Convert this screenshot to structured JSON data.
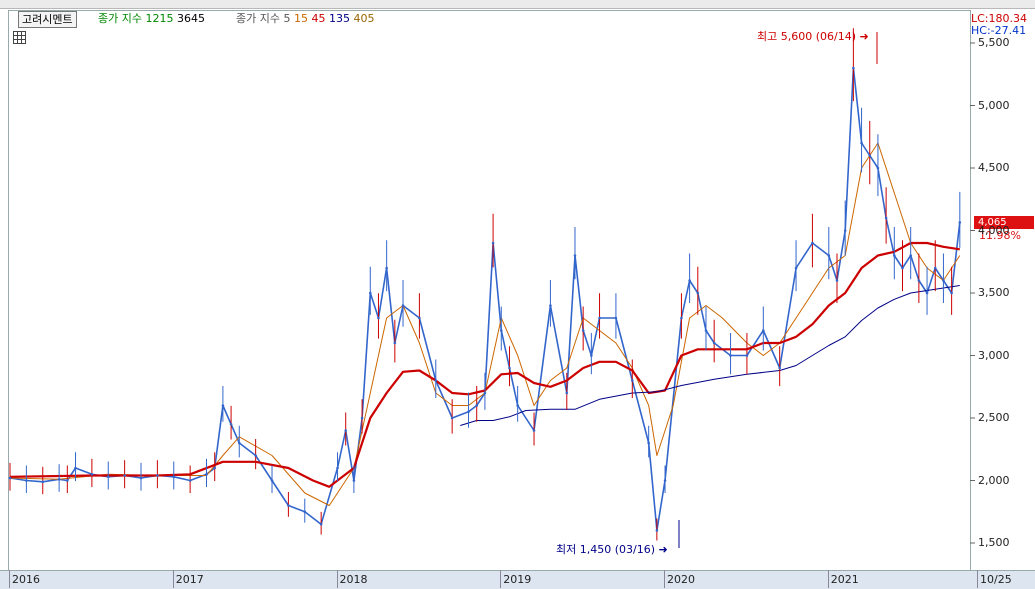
{
  "legend": {
    "stock_name": "고려시멘트",
    "ma_label": "종가 지수",
    "ma_periods": [
      "12",
      "15",
      "3645"
    ],
    "ma2_label": "종가 지수 5",
    "ma2_periods": [
      "15",
      "45",
      "135",
      "405"
    ]
  },
  "colors": {
    "candle": "#3366cc",
    "candle_up": "#dd2222",
    "ma_orange": "#cc6600",
    "ma_red": "#cc0000",
    "ma_navy": "#000088",
    "ma_green": "#008800"
  },
  "right_panel": {
    "lc": "LC:180.34",
    "hc": "HC:-27.41",
    "current_price": "4,065",
    "change_pct": "11.98%"
  },
  "annotations": {
    "high": "최고 5,600 (06/14)",
    "low": "최저 1,450 (03/16)"
  },
  "chart_data": {
    "type": "line",
    "title": "",
    "xlabel": "",
    "ylabel": "",
    "y_ticks": [
      "5,500",
      "5,000",
      "4,500",
      "4,000",
      "3,500",
      "3,000",
      "2,500",
      "2,000",
      "1,500"
    ],
    "x_ticks": [
      "2016",
      "2017",
      "2018",
      "2019",
      "2020",
      "2021",
      "10/25"
    ],
    "ylim": [
      1300,
      5700
    ],
    "xlim": [
      2016.0,
      2021.85
    ],
    "series": [
      {
        "name": "종가",
        "color": "#3366cc",
        "x": [
          2016.0,
          2016.1,
          2016.2,
          2016.3,
          2016.35,
          2016.4,
          2016.5,
          2016.6,
          2016.7,
          2016.8,
          2016.9,
          2017.0,
          2017.1,
          2017.2,
          2017.25,
          2017.3,
          2017.35,
          2017.4,
          2017.5,
          2017.6,
          2017.7,
          2017.8,
          2017.9,
          2018.0,
          2018.05,
          2018.1,
          2018.15,
          2018.2,
          2018.25,
          2018.3,
          2018.35,
          2018.4,
          2018.5,
          2018.6,
          2018.7,
          2018.8,
          2018.85,
          2018.9,
          2018.95,
          2019.0,
          2019.05,
          2019.1,
          2019.2,
          2019.3,
          2019.4,
          2019.45,
          2019.5,
          2019.55,
          2019.6,
          2019.7,
          2019.8,
          2019.9,
          2019.95,
          2020.0,
          2020.1,
          2020.15,
          2020.2,
          2020.25,
          2020.3,
          2020.4,
          2020.5,
          2020.6,
          2020.7,
          2020.8,
          2020.9,
          2021.0,
          2021.05,
          2021.1,
          2021.15,
          2021.2,
          2021.25,
          2021.3,
          2021.35,
          2021.4,
          2021.45,
          2021.5,
          2021.55,
          2021.6,
          2021.65,
          2021.7,
          2021.75,
          2021.8
        ],
        "y": [
          2020,
          2000,
          1990,
          2010,
          2000,
          2100,
          2050,
          2030,
          2040,
          2020,
          2040,
          2030,
          2000,
          2050,
          2100,
          2600,
          2450,
          2300,
          2200,
          2000,
          1800,
          1750,
          1650,
          2100,
          2400,
          2000,
          2500,
          3500,
          3300,
          3700,
          3100,
          3400,
          3300,
          2800,
          2500,
          2550,
          2600,
          2700,
          3900,
          3200,
          2900,
          2600,
          2400,
          3400,
          2700,
          3800,
          3200,
          3000,
          3300,
          3300,
          2800,
          2300,
          1600,
          2000,
          3300,
          3600,
          3500,
          3200,
          3100,
          3000,
          3000,
          3200,
          2900,
          3700,
          3900,
          3800,
          3600,
          4000,
          5300,
          4700,
          4600,
          4500,
          4100,
          3800,
          3700,
          3800,
          3600,
          3500,
          3700,
          3600,
          3500,
          4065
        ]
      },
      {
        "name": "15",
        "color": "#cc6600",
        "x": [
          2016.0,
          2016.3,
          2016.6,
          2016.9,
          2017.2,
          2017.3,
          2017.4,
          2017.6,
          2017.8,
          2017.95,
          2018.1,
          2018.2,
          2018.3,
          2018.4,
          2018.5,
          2018.6,
          2018.7,
          2018.8,
          2018.9,
          2019.0,
          2019.1,
          2019.2,
          2019.3,
          2019.4,
          2019.5,
          2019.6,
          2019.7,
          2019.8,
          2019.9,
          2019.95,
          2020.05,
          2020.15,
          2020.25,
          2020.35,
          2020.5,
          2020.6,
          2020.7,
          2020.8,
          2020.9,
          2021.0,
          2021.1,
          2021.2,
          2021.3,
          2021.4,
          2021.5,
          2021.6,
          2021.7,
          2021.8
        ],
        "y": [
          2020,
          2010,
          2050,
          2040,
          2040,
          2200,
          2350,
          2200,
          1900,
          1800,
          2100,
          2700,
          3300,
          3400,
          3100,
          2700,
          2600,
          2600,
          2700,
          3300,
          3000,
          2600,
          2800,
          2900,
          3300,
          3200,
          3100,
          2900,
          2600,
          2200,
          2600,
          3300,
          3400,
          3300,
          3100,
          3000,
          3100,
          3300,
          3500,
          3700,
          3800,
          4500,
          4700,
          4300,
          3900,
          3700,
          3600,
          3800
        ]
      },
      {
        "name": "45",
        "color": "#cc0000",
        "x": [
          2016.0,
          2016.5,
          2016.9,
          2017.1,
          2017.3,
          2017.5,
          2017.7,
          2017.85,
          2017.95,
          2018.1,
          2018.2,
          2018.3,
          2018.4,
          2018.5,
          2018.6,
          2018.7,
          2018.8,
          2018.9,
          2019.0,
          2019.1,
          2019.2,
          2019.3,
          2019.4,
          2019.5,
          2019.6,
          2019.7,
          2019.8,
          2019.9,
          2020.0,
          2020.1,
          2020.2,
          2020.3,
          2020.4,
          2020.5,
          2020.6,
          2020.7,
          2020.8,
          2020.9,
          2021.0,
          2021.1,
          2021.2,
          2021.3,
          2021.4,
          2021.5,
          2021.6,
          2021.7,
          2021.8
        ],
        "y": [
          2030,
          2040,
          2040,
          2050,
          2150,
          2150,
          2100,
          2000,
          1950,
          2100,
          2500,
          2700,
          2870,
          2880,
          2800,
          2700,
          2690,
          2720,
          2850,
          2860,
          2780,
          2750,
          2800,
          2900,
          2950,
          2950,
          2880,
          2700,
          2720,
          3000,
          3050,
          3050,
          3050,
          3050,
          3100,
          3100,
          3150,
          3250,
          3400,
          3500,
          3700,
          3800,
          3830,
          3900,
          3900,
          3870,
          3850
        ]
      },
      {
        "name": "135",
        "color": "#000088",
        "x": [
          2018.75,
          2018.85,
          2018.95,
          2019.05,
          2019.15,
          2019.3,
          2019.45,
          2019.6,
          2019.8,
          2019.95,
          2020.1,
          2020.3,
          2020.5,
          2020.7,
          2020.8,
          2020.9,
          2021.0,
          2021.1,
          2021.2,
          2021.3,
          2021.4,
          2021.5,
          2021.6,
          2021.7,
          2021.8
        ],
        "y": [
          2440,
          2480,
          2480,
          2510,
          2560,
          2570,
          2570,
          2650,
          2700,
          2710,
          2760,
          2810,
          2850,
          2880,
          2920,
          3000,
          3080,
          3150,
          3280,
          3380,
          3450,
          3500,
          3520,
          3540,
          3560
        ]
      }
    ]
  }
}
